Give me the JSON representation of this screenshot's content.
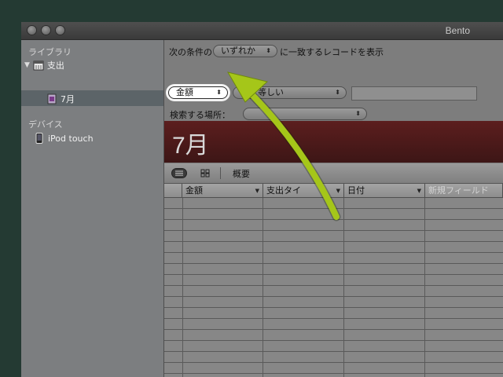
{
  "window": {
    "title": "Bento"
  },
  "sidebar": {
    "library_header": "ライブラリ",
    "library_items": [
      {
        "label": "支出",
        "icon": "calendar-icon"
      },
      {
        "label": "7月",
        "icon": "smart-collection-icon"
      }
    ],
    "devices_header": "デバイス",
    "device_items": [
      {
        "label": "iPod touch",
        "icon": "ipod-icon"
      }
    ]
  },
  "filter": {
    "prefix": "次の条件の",
    "match_select": "いずれか",
    "suffix": "に一致するレコードを表示",
    "field_select": "金額",
    "operator_select": "次と等しい",
    "value": "",
    "search_location_label": "検索する場所："
  },
  "collection": {
    "title": "7月"
  },
  "toolbar": {
    "summary_label": "概要"
  },
  "table": {
    "columns": [
      "金額",
      "支出タイ",
      "日付",
      "新規フィールド"
    ]
  },
  "colors": {
    "arrow": "#a5c619",
    "banner": "#4a1a1a"
  }
}
